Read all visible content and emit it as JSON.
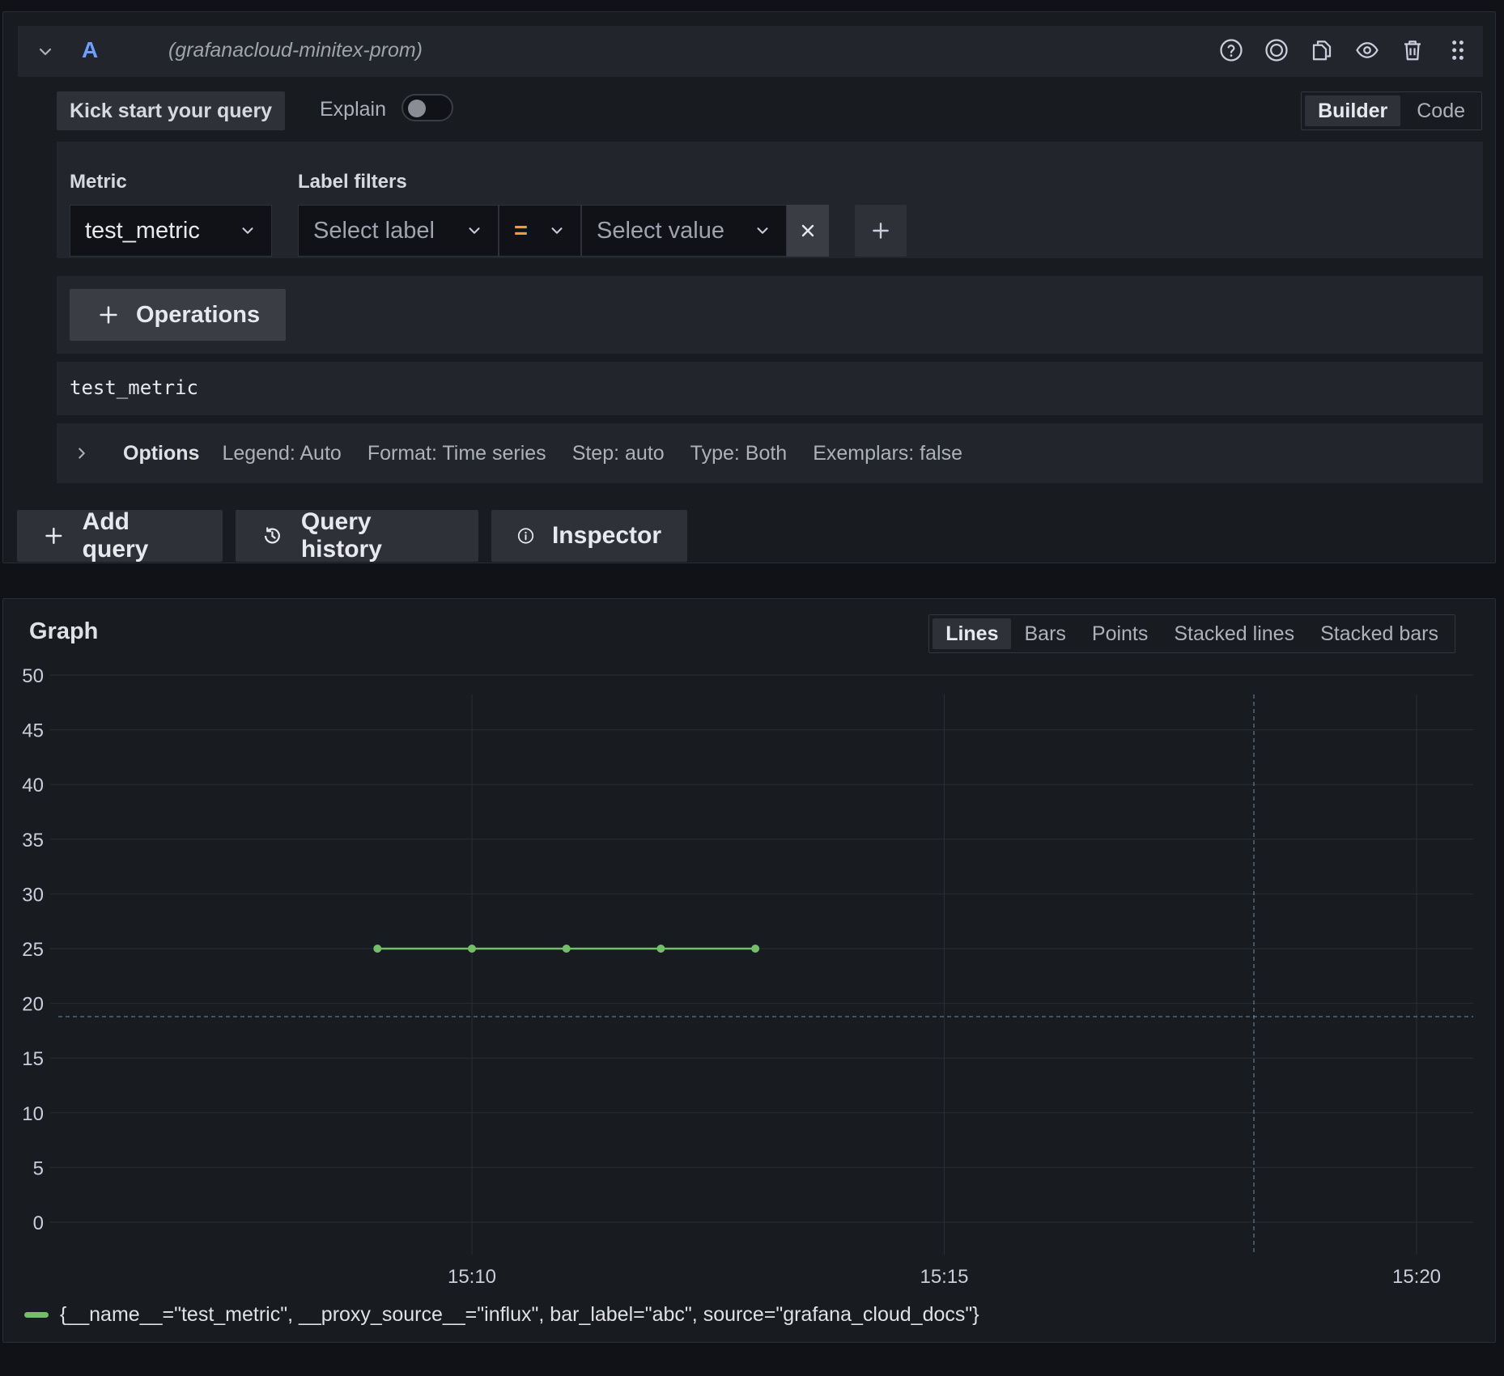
{
  "query_row": {
    "letter": "A",
    "datasource": "(grafanacloud-minitex-prom)",
    "icons": [
      "help-icon",
      "target-icon",
      "duplicate-icon",
      "eye-icon",
      "trash-icon",
      "drag-handle-icon"
    ]
  },
  "toolbar": {
    "kick_start_label": "Kick start your query",
    "explain_label": "Explain",
    "explain_enabled": false,
    "modes": [
      "Builder",
      "Code"
    ],
    "active_mode": "Builder"
  },
  "builder": {
    "metric_label": "Metric",
    "metric_value": "test_metric",
    "label_filters_label": "Label filters",
    "label_placeholder": "Select label",
    "operator": "=",
    "value_placeholder": "Select value",
    "operations_label": "Operations"
  },
  "raw_query": "test_metric",
  "options": {
    "title": "Options",
    "legend": "Legend: Auto",
    "format": "Format: Time series",
    "step": "Step: auto",
    "type": "Type: Both",
    "exemplars": "Exemplars: false"
  },
  "actions": {
    "add_query": "Add query",
    "query_history": "Query history",
    "inspector": "Inspector"
  },
  "graph": {
    "title": "Graph",
    "types": [
      "Lines",
      "Bars",
      "Points",
      "Stacked lines",
      "Stacked bars"
    ],
    "active_type": "Lines",
    "legend_label": "{__name__=\"test_metric\", __proxy_source__=\"influx\", bar_label=\"abc\", source=\"grafana_cloud_docs\"}",
    "series_color": "#73bf69"
  },
  "chart_data": {
    "type": "line",
    "x_ticks": [
      "15:10",
      "15:15",
      "15:20"
    ],
    "y_ticks": [
      0,
      5,
      10,
      15,
      20,
      25,
      30,
      35,
      40,
      45,
      50
    ],
    "ylim": [
      0,
      50
    ],
    "grid": true,
    "series": [
      {
        "name": "{__name__=\"test_metric\", __proxy_source__=\"influx\", bar_label=\"abc\", source=\"grafana_cloud_docs\"}",
        "x": [
          "15:09",
          "15:10",
          "15:11",
          "15:12",
          "15:13"
        ],
        "values": [
          25,
          25,
          25,
          25,
          25
        ]
      }
    ]
  }
}
